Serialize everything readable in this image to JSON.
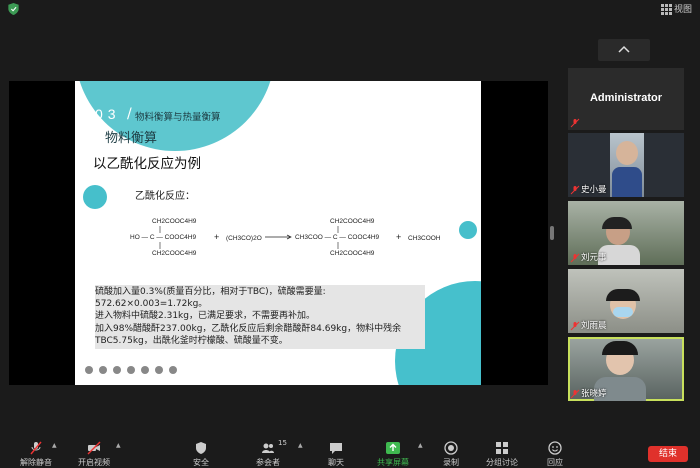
{
  "topbar": {
    "view_label": "视图"
  },
  "slide": {
    "section_num": "03",
    "section_slash": "/",
    "section_title": "物料衡算与热量衡算",
    "subtitle": "物料衡算",
    "heading": "以乙酰化反应为例",
    "reaction_label": "乙酰化反应：",
    "formula": {
      "left_top": "CH2COOC4H9",
      "left_mid": "HO — C — COOC4H9",
      "left_bot": "CH2COOC4H9",
      "plus1": "+",
      "reagent": "(CH3CO)2O",
      "right_top": "CH2COOC4H9",
      "right_mid": "CH3COO — C — COOC4H9",
      "right_bot": "CH2COOC4H9",
      "plus2": "+",
      "product2": "CH3COOH"
    },
    "text_lines": [
      "硫酸加入量0.3%(质量百分比，相对于TBC)，硫酸需要量:",
      "572.62×0.003=1.72kg。",
      "进入物料中硫酸2.31kg，已满足要求，不需要再补加。",
      "加入98%醋酸酐237.00kg，乙酰化反应后剩余醋酸酐84.69kg，物料中残余",
      "TBC5.75kg，出酰化釜时柠檬酸、硫酸量不变。"
    ]
  },
  "participants": {
    "admin": "Administrator",
    "tiles": [
      {
        "name": "史小曼",
        "bg": "#7d8a97"
      },
      {
        "name": "刘元事",
        "bg": "#5f6e58"
      },
      {
        "name": "刘雨晨",
        "bg": "#8c8f87"
      },
      {
        "name": "张晓婷",
        "bg": "#6b7572"
      }
    ]
  },
  "toolbar": {
    "items": [
      {
        "label": "解除静音",
        "icon": "mic-muted-icon"
      },
      {
        "label": "开启视频",
        "icon": "video-off-icon"
      },
      {
        "label": "安全",
        "icon": "shield-icon"
      },
      {
        "label": "参会者",
        "icon": "participants-icon",
        "count": "15"
      },
      {
        "label": "聊天",
        "icon": "chat-icon"
      },
      {
        "label": "共享屏幕",
        "icon": "share-screen-icon"
      },
      {
        "label": "录制",
        "icon": "record-icon"
      },
      {
        "label": "分组讨论",
        "icon": "breakout-icon"
      },
      {
        "label": "回应",
        "icon": "reaction-icon"
      }
    ],
    "end_label": "结束"
  },
  "colors": {
    "accent": "#46c0cc",
    "end": "#e0312b",
    "share": "#3fb950",
    "highlight": "#c8e05c"
  }
}
